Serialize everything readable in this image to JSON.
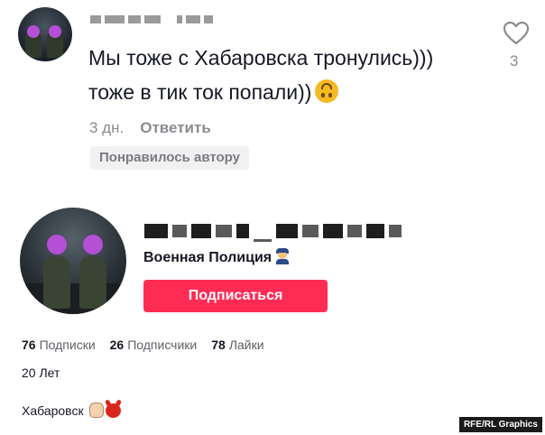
{
  "comment": {
    "text_line1": "Мы тоже с Хабаровска тронулись)))",
    "text_line2": "тоже в тик ток попали))",
    "time": "3 дн.",
    "reply_label": "Ответить",
    "badge": "Понравилось автору",
    "like_count": "3",
    "emoji": "upside-down-face"
  },
  "profile": {
    "bio_title": "Военная Полиция",
    "bio_emoji": "police-officer",
    "follow_label": "Подписаться",
    "stats": [
      {
        "value": "76",
        "label": "Подписки"
      },
      {
        "value": "26",
        "label": "Подписчики"
      },
      {
        "value": "78",
        "label": "Лайки"
      }
    ],
    "age": "20 Лет",
    "city": "Хабаровск",
    "city_emojis": [
      "fist",
      "devil"
    ]
  },
  "credit": "RFE/RL Graphics",
  "colors": {
    "follow_button": "#fe2c55",
    "muted_text": "#8a8b91",
    "badge_bg": "#f1f1f2"
  }
}
